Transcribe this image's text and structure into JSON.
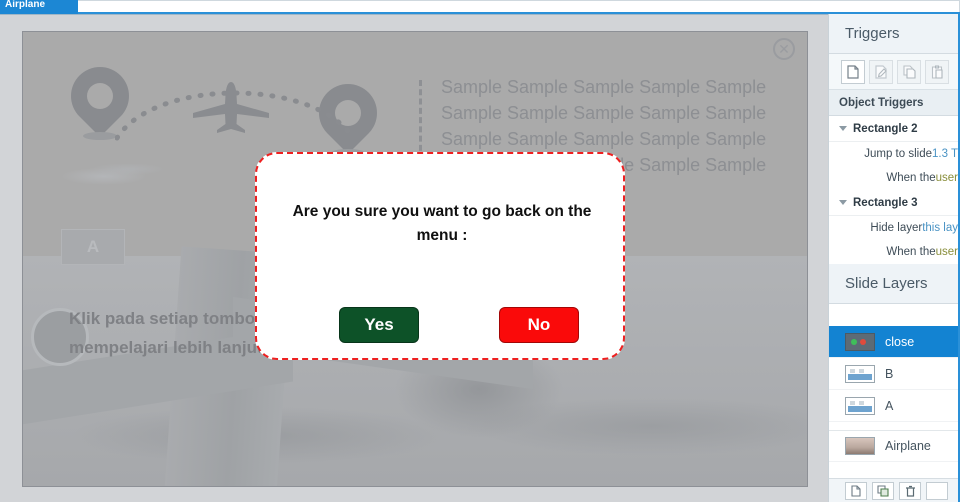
{
  "tab": {
    "label": "Airplane"
  },
  "slide": {
    "close_icon": "close-circle-icon",
    "sample_lines": [
      "Sample Sample Sample Sample Sample",
      "Sample Sample Sample Sample Sample",
      "Sample Sample Sample Sample Sample",
      "Sample Sample Sample Sample Sample"
    ],
    "button_a_label": "A",
    "caption_lines": [
      "Klik pada setiap tombol untuk",
      "mempelajari lebih lanjut"
    ]
  },
  "modal": {
    "title": "Are you sure you want to go back on the menu :",
    "yes_label": "Yes",
    "no_label": "No",
    "yes_color": "#0d5228",
    "no_color": "#fa0a0a",
    "border_color": "#ee2020"
  },
  "triggers_panel": {
    "header": "Triggers",
    "toolbar": [
      {
        "name": "new-trigger-icon",
        "glyph": "⬜"
      },
      {
        "name": "edit-trigger-icon",
        "glyph": "✎"
      },
      {
        "name": "copy-trigger-icon",
        "glyph": "⧉"
      },
      {
        "name": "paste-trigger-icon",
        "glyph": "❐"
      }
    ],
    "section_title": "Object Triggers",
    "groups": [
      {
        "name": "Rectangle 2",
        "lines": [
          {
            "lead": "Jump to slide ",
            "token": "1.3 T",
            "tail": ""
          },
          {
            "lead": "When the ",
            "token": "user",
            "tail": ""
          }
        ]
      },
      {
        "name": "Rectangle 3",
        "lines": [
          {
            "lead": "Hide layer ",
            "token": "this lay",
            "tail": ""
          },
          {
            "lead": "When the ",
            "token": "user",
            "tail": ""
          }
        ]
      }
    ]
  },
  "layers_panel": {
    "header": "Slide Layers",
    "items": [
      {
        "label": "close",
        "selected": true,
        "thumb": "dark"
      },
      {
        "label": "B",
        "selected": false,
        "thumb": "slide"
      },
      {
        "label": "A",
        "selected": false,
        "thumb": "slide"
      },
      {
        "label": "Airplane",
        "selected": false,
        "thumb": "photo"
      }
    ],
    "footer_buttons": [
      {
        "name": "new-layer-icon",
        "glyph": "⬜"
      },
      {
        "name": "duplicate-layer-icon",
        "glyph": "⧉"
      },
      {
        "name": "delete-layer-icon",
        "glyph": "🗑"
      }
    ]
  }
}
